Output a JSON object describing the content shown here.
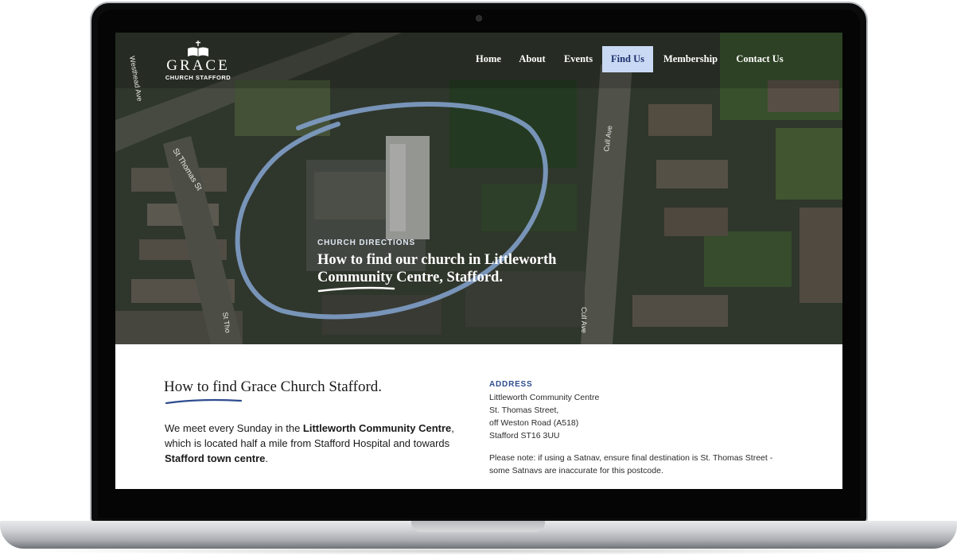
{
  "brand": {
    "name": "GRACE",
    "sub": "CHURCH STAFFORD"
  },
  "nav": {
    "items": [
      {
        "label": "Home"
      },
      {
        "label": "About"
      },
      {
        "label": "Events"
      },
      {
        "label": "Find Us"
      },
      {
        "label": "Membership"
      },
      {
        "label": "Contact Us"
      }
    ],
    "active": "Find Us"
  },
  "hero": {
    "kicker": "CHURCH DIRECTIONS",
    "heading": "How to find our church in Littleworth Community Centre, Stafford."
  },
  "map_labels": {
    "westhead": "Westhead Ave",
    "st_thomas": "St Thomas St",
    "cull": "Cull Ave",
    "st_tho": "St Tho"
  },
  "section": {
    "title": "How to find Grace Church Stafford.",
    "para_1": "We meet every Sunday in the ",
    "para_bold_1": "Littleworth Community Centre",
    "para_2": ", which is located half a mile from Stafford Hospital and towards ",
    "para_bold_2": "Stafford town centre",
    "para_3": "."
  },
  "address": {
    "label": "ADDRESS",
    "lines": [
      "Littleworth Community Centre",
      "St. Thomas Street,",
      "off Weston Road (A518)",
      "Stafford ST16 3UU"
    ],
    "note": "Please note: if using a Satnav, ensure final destination is St. Thomas Street - some Satnavs are inaccurate for this postcode."
  },
  "colors": {
    "accent": "#2e4d8f",
    "nav_active_bg": "#c9d9f4",
    "circle": "#7f9cc4"
  }
}
